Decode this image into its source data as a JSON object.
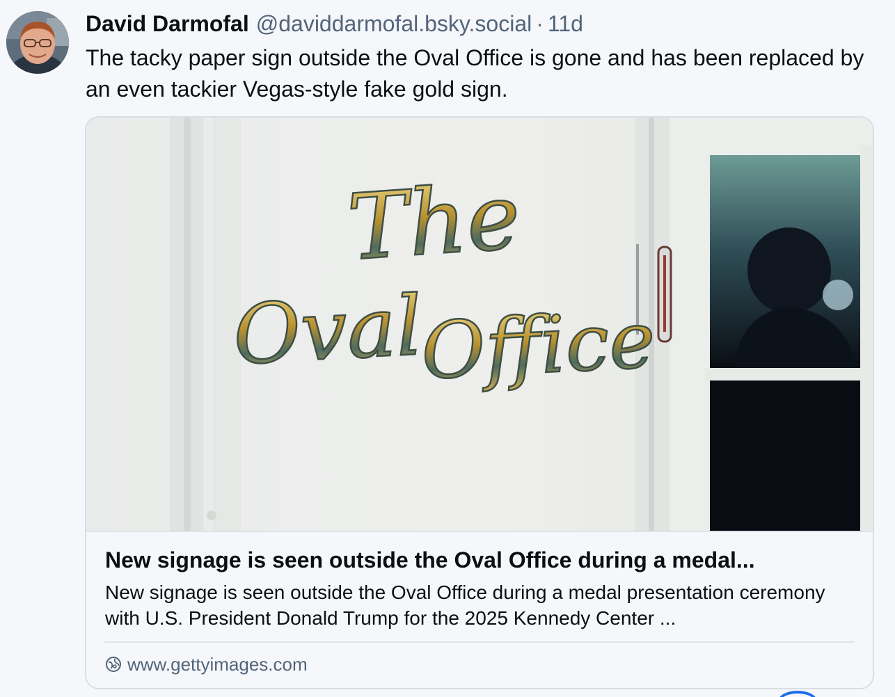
{
  "post": {
    "author_name": "David Darmofal",
    "author_handle": "@daviddarmofal.bsky.social",
    "separator": "·",
    "timestamp": "11d",
    "text": "The tacky paper sign outside the Oval Office is gone and has been replaced by an even tackier Vegas-style fake gold sign.",
    "avatar_icon": "person-photo-avatar"
  },
  "embed": {
    "image_sign_lettering": [
      "The",
      "Oval Office"
    ],
    "title": "New signage is seen outside the Oval Office during a medal...",
    "description": "New signage is seen outside the Oval Office during a medal presentation ceremony with U.S. President Donald Trump for the 2025 Kennedy Center ...",
    "domain": "www.gettyimages.com",
    "domain_icon": "globe-icon"
  },
  "colors": {
    "background": "#f6f7fa",
    "text_primary": "#0b0f14",
    "text_secondary": "#52647a",
    "card_border": "#d9dee5",
    "accent": "#1d6fe8"
  }
}
